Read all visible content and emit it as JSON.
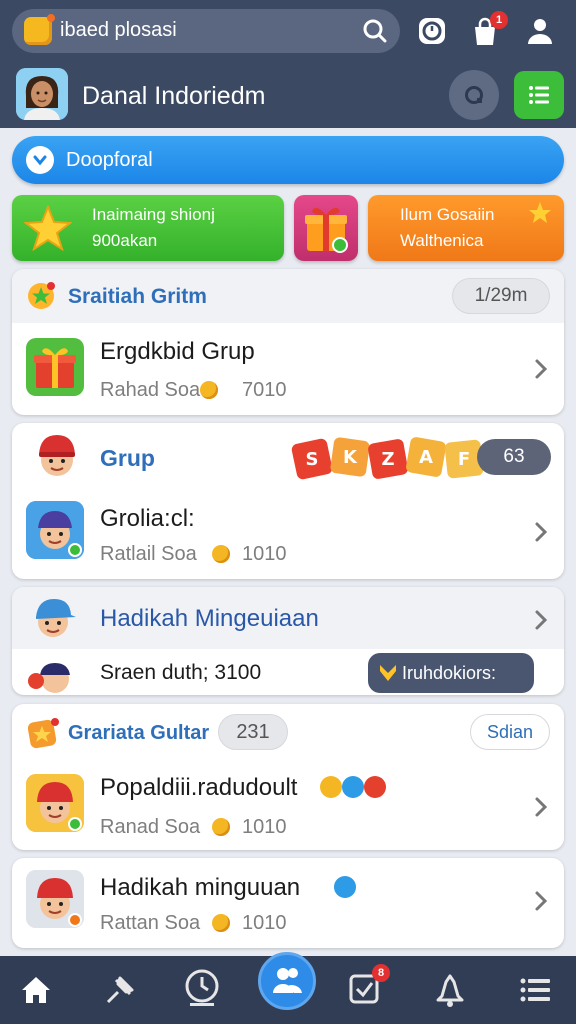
{
  "top_bar": {
    "search_text": "ibaed plosasi",
    "cart_badge": "1"
  },
  "profile": {
    "name": "Danal Indoriedm"
  },
  "banner": {
    "text": "Doopforal"
  },
  "promos": {
    "green_line1": "Inaimaing shionj",
    "green_line2": "900akan",
    "orange_line1": "Ilum Gosaiin",
    "orange_line2": "Walthenica"
  },
  "section1": {
    "title": "Sraitiah Gritm",
    "pill": "1/29m",
    "item_title": "Ergdkbid Grup",
    "item_sub_left": "Rahad Soa",
    "item_sub_value": "7010"
  },
  "section2": {
    "title": "Grup",
    "pill": "63",
    "item_title": "Grolia:cl:",
    "item_sub_left": "Ratlail Soa",
    "item_sub_value": "1010"
  },
  "section3": {
    "title": "Hadikah Mingeuiaan",
    "sub_text": "Sraen duth; 3100",
    "button": "Iruhdokiors:"
  },
  "section4": {
    "title": "Grariata Gultar",
    "count_pill": "231",
    "right_pill": "Sdian",
    "item_title": "Popaldiii.radudoult",
    "item_sub_left": "Ranad Soa",
    "item_sub_value": "1010"
  },
  "section5": {
    "item_title": "Hadikah minguuan",
    "item_sub_left": "Rattan Soa",
    "item_sub_value": "1010"
  },
  "bottom_nav": {
    "badge": "8"
  },
  "colors": {
    "header": "#3c4963",
    "blue_bar": "#1b86e8",
    "promo_green": "#34b12b",
    "promo_orange": "#f07818",
    "section_title": "#2f6fb9",
    "nav": "#313c55"
  }
}
